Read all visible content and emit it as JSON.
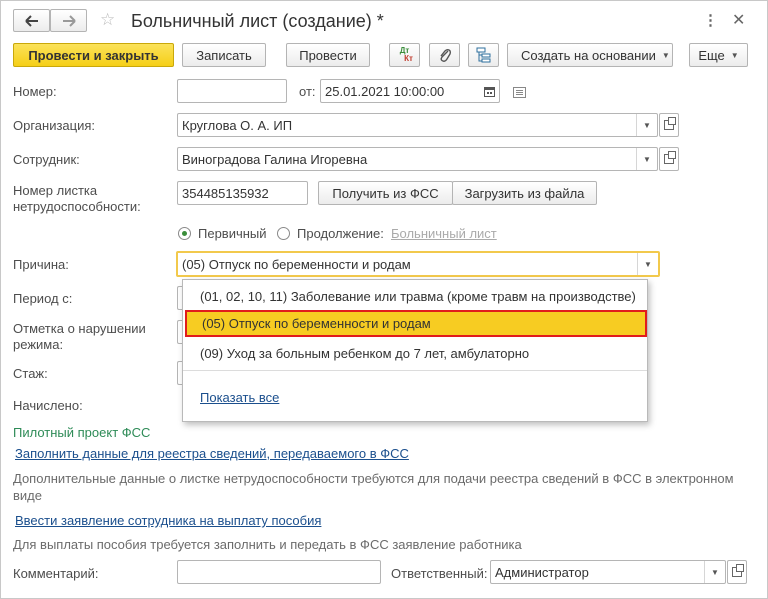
{
  "title": "Больничный лист (создание) *",
  "toolbar": {
    "post_close": "Провести и закрыть",
    "save": "Записать",
    "post": "Провести",
    "dtkt_top": "Дт",
    "dtkt_bottom": "Кт",
    "create_based": "Создать на основании",
    "more": "Еще"
  },
  "form": {
    "number_label": "Номер:",
    "number_value": "",
    "from_label": "от:",
    "date_value": "25.01.2021 10:00:00",
    "org_label": "Организация:",
    "org_value": "Круглова О. А. ИП",
    "employee_label": "Сотрудник:",
    "employee_value": "Виноградова Галина Игоревна",
    "sheet_label_1": "Номер листка",
    "sheet_label_2": "нетрудоспособности:",
    "sheet_value": "354485135932",
    "get_fss": "Получить из ФСС",
    "load_file": "Загрузить из файла",
    "radio_primary": "Первичный",
    "radio_continue": "Продолжение:",
    "sick_leave_link": "Больничный лист",
    "reason_label": "Причина:",
    "reason_value": "(05) Отпуск по беременности и родам",
    "period_label": "Период с:",
    "violation_label_1": "Отметка о нарушении",
    "violation_label_2": "режима:",
    "experience_label": "Стаж:",
    "accrued_label": "Начислено:",
    "pilot_label": "Пилотный проект ФСС",
    "fill_data_link": "Заполнить данные для реестра сведений, передаваемого в ФСС",
    "additional_info_1": "Дополнительные данные о листке нетрудоспособности требуются для подачи реестра сведений в ФСС в электронном",
    "additional_info_2": "виде",
    "enter_statement_link": "Ввести заявление сотрудника на выплату пособия",
    "payment_info": "Для выплаты пособия требуется заполнить и передать в ФСС заявление работника",
    "comment_label": "Комментарий:",
    "comment_value": "",
    "responsible_label": "Ответственный:",
    "responsible_value": "Администратор"
  },
  "dropdown": {
    "options": [
      "(01, 02, 10, 11) Заболевание или травма (кроме травм на производстве)",
      "(05) Отпуск по беременности и родам",
      "(09) Уход за больным ребенком до 7 лет, амбулаторно"
    ],
    "selected_index": 1,
    "show_all": "Показать все"
  },
  "colors": {
    "primary_button": "#f5cf17",
    "selected_option": "#f7cc22",
    "selected_border": "#e11c1c",
    "link": "#1b4f8d",
    "pilot_text": "#2e8b57"
  }
}
